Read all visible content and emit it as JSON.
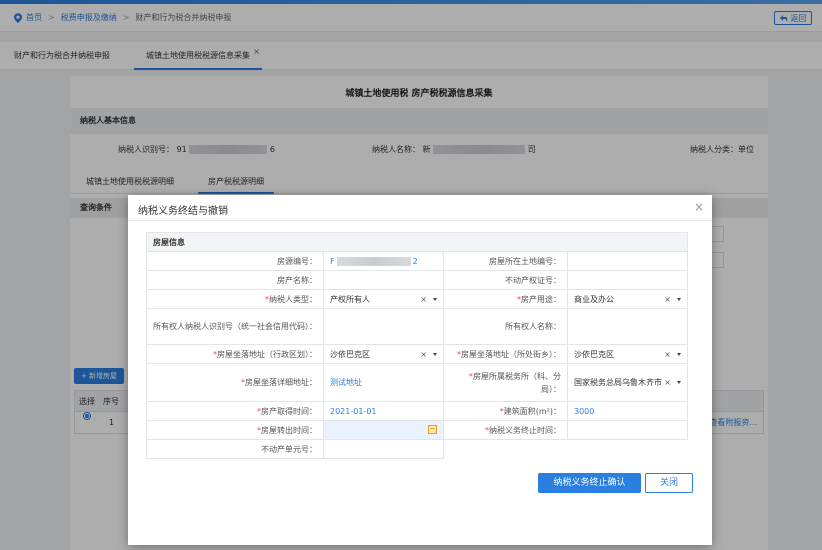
{
  "breadcrumb": {
    "home": "首页",
    "level1": "税费申报及缴纳",
    "level2": "财产和行为税合并纳税申报"
  },
  "back_label": "返回",
  "tabs": [
    {
      "label": "财产和行为税合并纳税申报"
    },
    {
      "label": "城镇土地使用税税源信息采集",
      "close": "×"
    }
  ],
  "page_title": "城镇土地使用税  房产税税源信息采集",
  "taxpayer_section": {
    "title": "纳税人基本信息",
    "id_label": "纳税人识别号：",
    "id_prefix": "91",
    "id_suffix": "6",
    "name_label": "纳税人名称：",
    "name_prefix": "新",
    "name_suffix": "司",
    "category": "纳税人分类：单位"
  },
  "sub_tabs": [
    "城镇土地使用税税源明细",
    "房产税税源明细"
  ],
  "query_label": "查询条件",
  "add_button": "+ 新增房屋",
  "list": {
    "headers": [
      "选择",
      "序号"
    ],
    "row_index": "1",
    "row_action": "查看附报资..."
  },
  "modal": {
    "title": "纳税义务终结与撤销",
    "close": "×",
    "section": "房屋信息",
    "fields": {
      "house_no_label": "房源编号：",
      "house_no_prefix": "F",
      "house_no_suffix": "2",
      "land_no_label": "房屋所在土地编号：",
      "property_name_label": "房产名称：",
      "cert_no_label": "不动产权证号：",
      "taxpayer_type_label": "纳税人类型：",
      "taxpayer_type_value": "产权所有人",
      "usage_label": "房产用途：",
      "usage_value": "商业及办公",
      "owner_id_label": "所有权人纳税人识别号（统一社会信用代码）：",
      "owner_name_label": "所有权人名称：",
      "district_label": "房屋坐落地址（行政区划）：",
      "district_value": "沙依巴克区",
      "street_label": "房屋坐落地址（所处街乡）：",
      "street_value": "沙依巴克区",
      "address_label": "房屋坐落详细地址：",
      "address_value": "测试地址",
      "tax_office_label": "房屋所属税务所（科、分局）：",
      "tax_office_value": "国家税务总局乌鲁木齐市",
      "acquire_time_label": "房产取得时间：",
      "acquire_time_value": "2021-01-01",
      "area_label": "建筑面积(m²)：",
      "area_value": "3000",
      "transfer_time_label": "房屋转出时间：",
      "obligation_end_label": "纳税义务终止时间：",
      "unit_no_label": "不动产单元号："
    },
    "confirm_button": "纳税义务终止确认",
    "close_button": "关闭"
  },
  "colors": {
    "primary": "#2a7fe0",
    "required": "#ee4444"
  },
  "icons": {
    "location": "location-pin-icon",
    "back": "back-arrow-icon",
    "calendar": "calendar-icon",
    "clear": "clear-x-icon",
    "dropdown": "caret-down-icon"
  }
}
